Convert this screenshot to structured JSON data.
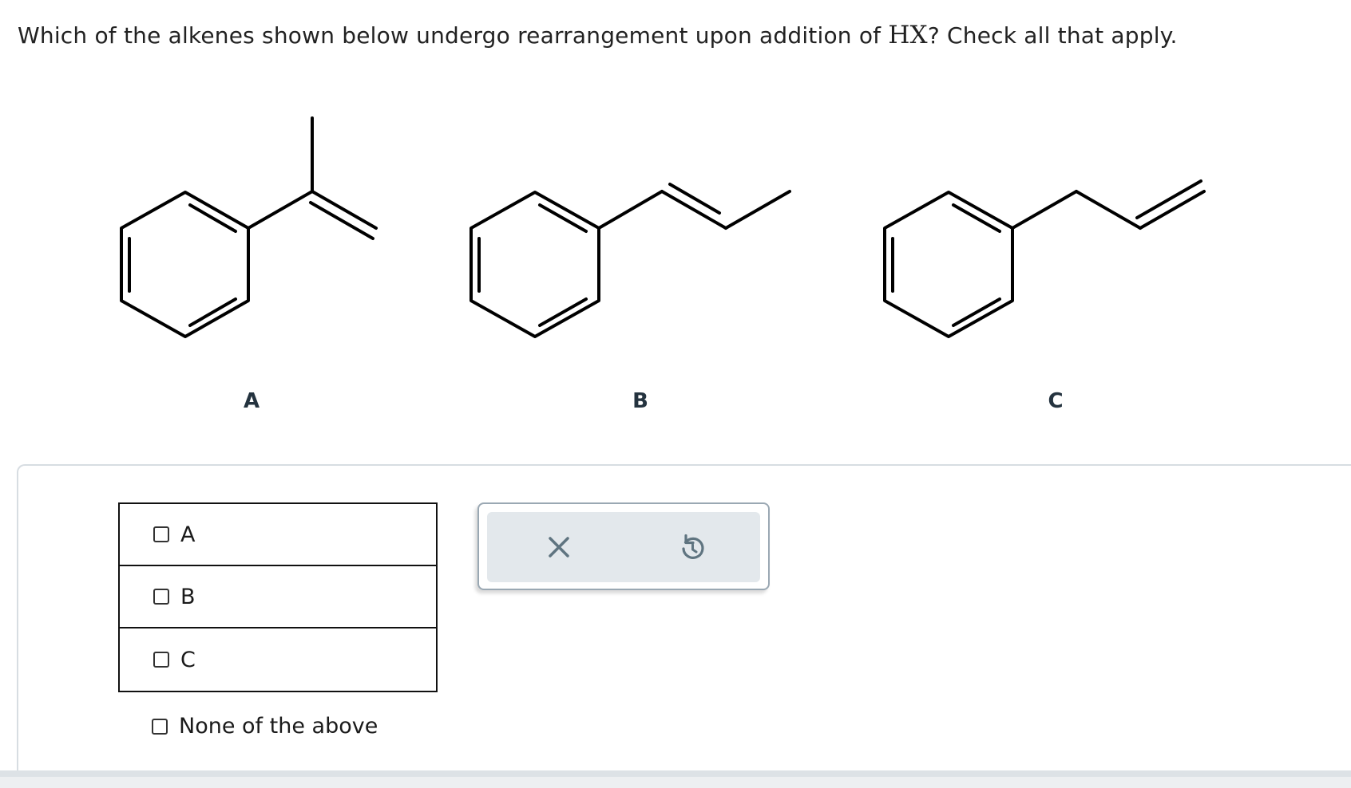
{
  "question": {
    "prefix": "Which of the alkenes shown below undergo rearrangement upon addition of ",
    "formula": "HX",
    "suffix": "? Check all that apply."
  },
  "molecules": [
    {
      "label": "A"
    },
    {
      "label": "B"
    },
    {
      "label": "C"
    }
  ],
  "choices": [
    {
      "label": "A",
      "checked": false
    },
    {
      "label": "B",
      "checked": false
    },
    {
      "label": "C",
      "checked": false
    }
  ],
  "none_option": {
    "label": "None of the above",
    "checked": false
  },
  "tools": {
    "clear_icon": "close-icon",
    "reset_icon": "undo-icon"
  },
  "colors": {
    "tool_panel_bg": "#e3e8ec",
    "tool_icon": "#5f7480",
    "label_text": "#24333f"
  }
}
